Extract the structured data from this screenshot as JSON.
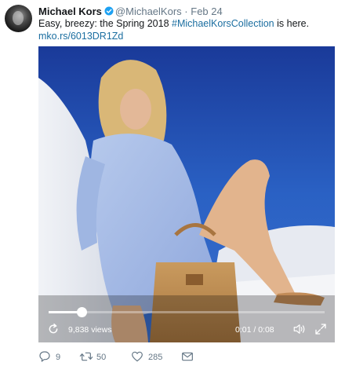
{
  "tweet": {
    "author_name": "Michael Kors",
    "handle": "@MichaelKors",
    "separator": "·",
    "date": "Feb 24",
    "text_before": "Easy, breezy: the Spring 2018 ",
    "hashtag": "#MichaelKorsCollection",
    "text_after": " is here.",
    "link": "mko.rs/6013DR1Zd"
  },
  "video": {
    "views": "9,838 views",
    "time": "0:01 / 0:08",
    "progress": 0.12
  },
  "actions": {
    "replies": "9",
    "retweets": "50",
    "likes": "285"
  },
  "icons": {
    "verified": "verified-badge-icon",
    "replay": "replay-icon",
    "volume": "volume-icon",
    "fullscreen": "fullscreen-icon",
    "reply": "reply-icon",
    "retweet": "retweet-icon",
    "like": "heart-icon",
    "dm": "envelope-icon"
  },
  "colors": {
    "verified": "#1da1f2",
    "link": "#1b6ea0",
    "muted": "#657786"
  }
}
